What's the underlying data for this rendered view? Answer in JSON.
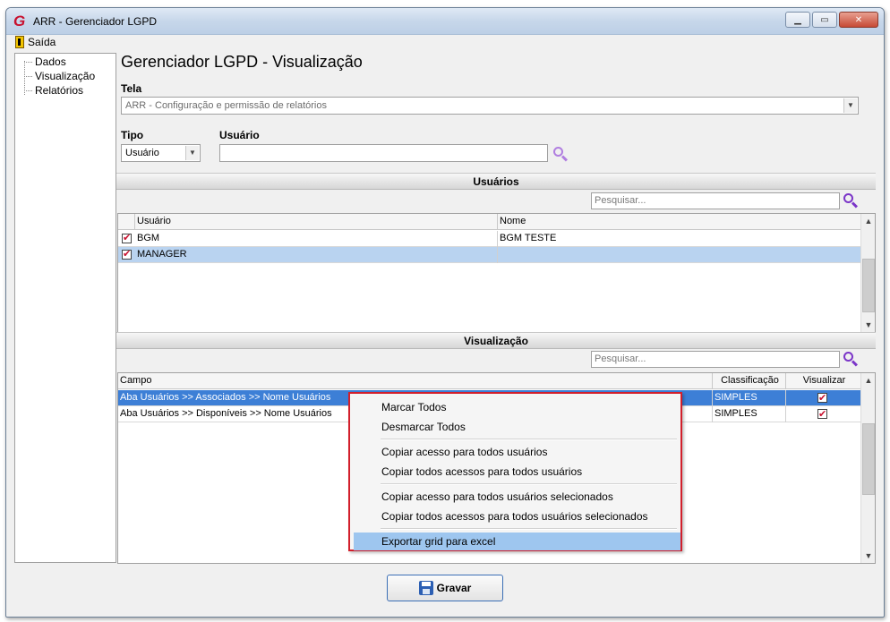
{
  "window": {
    "title": "ARR - Gerenciador LGPD",
    "logo_glyph": "G"
  },
  "menu": {
    "exit_label": "Saída"
  },
  "tree": {
    "items": [
      "Dados",
      "Visualização",
      "Relatórios"
    ]
  },
  "main": {
    "title": "Gerenciador LGPD - Visualização",
    "tela_label": "Tela",
    "tela_value": "ARR - Configuração e permissão de relatórios",
    "tipo_label": "Tipo",
    "tipo_value": "Usuário",
    "usuario_label": "Usuário",
    "usuario_value": ""
  },
  "users_section": {
    "header": "Usuários",
    "search_placeholder": "Pesquisar...",
    "columns": [
      "Usuário",
      "Nome"
    ],
    "rows": [
      {
        "usuario": "BGM",
        "nome": "BGM TESTE",
        "checked": true
      },
      {
        "usuario": "MANAGER",
        "nome": "",
        "checked": true
      }
    ]
  },
  "vis_section": {
    "header": "Visualização",
    "search_placeholder": "Pesquisar...",
    "columns": [
      "Campo",
      "Classificação",
      "Visualizar"
    ],
    "rows": [
      {
        "campo": "Aba Usuários >> Associados >> Nome Usuários",
        "classificacao": "SIMPLES",
        "visualizar": true
      },
      {
        "campo": "Aba Usuários >> Disponíveis >> Nome Usuários",
        "classificacao": "SIMPLES",
        "visualizar": true
      }
    ]
  },
  "context_menu": {
    "items": [
      "Marcar Todos",
      "Desmarcar Todos",
      "Copiar acesso para todos usuários",
      "Copiar todos acessos para todos usuários",
      "Copiar acesso para todos usuários selecionados",
      "Copiar todos acessos para todos usuários selecionados",
      "Exportar grid para excel"
    ],
    "highlighted": "Exportar grid para excel"
  },
  "footer": {
    "save_label": "Gravar"
  },
  "colors": {
    "accent": "#3d7fd6",
    "highlight_border": "#d21f2b",
    "check": "#c8102e",
    "search_icon": "#7b35c8"
  }
}
